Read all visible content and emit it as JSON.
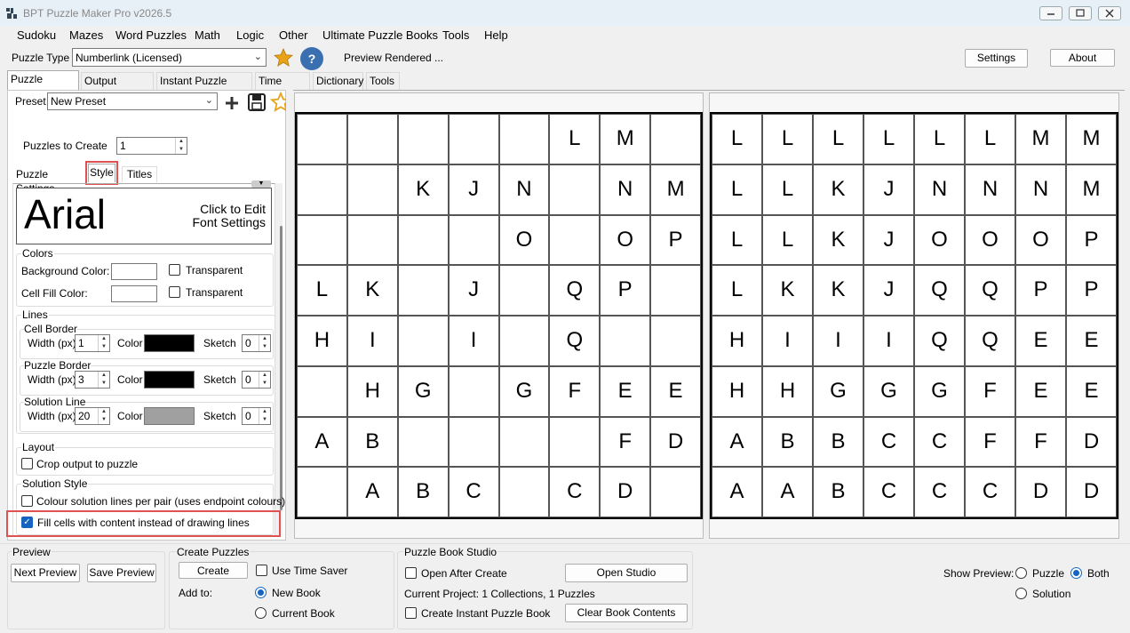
{
  "window": {
    "title": "BPT Puzzle Maker Pro v2026.5"
  },
  "menu": [
    "Sudoku",
    "Mazes",
    "Word Puzzles",
    "Math",
    "Logic",
    "Other",
    "Ultimate Puzzle Books",
    "Tools",
    "Help"
  ],
  "toolbar": {
    "puzzle_type_label": "Puzzle Type",
    "puzzle_type_value": "Numberlink (Licensed)",
    "status": "Preview Rendered ...",
    "settings_label": "Settings",
    "about_label": "About",
    "help_glyph": "?"
  },
  "main_tabs": [
    "Puzzle Settings",
    "Output Settings",
    "Instant Puzzle Books",
    "Time Saver",
    "Dictionary",
    "Tools"
  ],
  "preset": {
    "label": "Preset",
    "value": "New Preset"
  },
  "puzzles_to_create": {
    "label": "Puzzles to Create",
    "value": "1"
  },
  "sub_tabs": [
    "Puzzle Settings",
    "Style",
    "Titles"
  ],
  "font_preview": {
    "font_name": "Arial",
    "hint_line1": "Click to Edit",
    "hint_line2": "Font Settings"
  },
  "colors": {
    "heading": "Colors",
    "background_label": "Background Color:",
    "cell_fill_label": "Cell Fill Color:",
    "transparent_label": "Transparent"
  },
  "lines": {
    "heading": "Lines",
    "width_label": "Width (px)",
    "color_label": "Color",
    "sketch_label": "Sketch",
    "cell_border": {
      "title": "Cell Border",
      "width": "1",
      "sketch": "0",
      "color": "#000000"
    },
    "puzzle_border": {
      "title": "Puzzle Border",
      "width": "3",
      "sketch": "0",
      "color": "#000000"
    },
    "solution_line": {
      "title": "Solution Line",
      "width": "20",
      "sketch": "0",
      "color": "#a0a0a0"
    }
  },
  "layout": {
    "heading": "Layout",
    "crop_label": "Crop output to puzzle"
  },
  "solution_style": {
    "heading": "Solution Style",
    "colour_lines_label": "Colour solution lines per pair (uses endpoint colours)",
    "fill_cells_label": "Fill cells with content instead of drawing lines",
    "fill_cells_checked": true
  },
  "puzzle_grid": [
    [
      "",
      "",
      "",
      "",
      "",
      "L",
      "M",
      ""
    ],
    [
      "",
      "",
      "K",
      "J",
      "N",
      "",
      "N",
      "M"
    ],
    [
      "",
      "",
      "",
      "",
      "O",
      "",
      "O",
      "P"
    ],
    [
      "L",
      "K",
      "",
      "J",
      "",
      "Q",
      "P",
      ""
    ],
    [
      "H",
      "I",
      "",
      "I",
      "",
      "Q",
      "",
      ""
    ],
    [
      "",
      "H",
      "G",
      "",
      "G",
      "F",
      "E",
      "E"
    ],
    [
      "A",
      "B",
      "",
      "",
      "",
      "",
      "F",
      "D"
    ],
    [
      "",
      "A",
      "B",
      "C",
      "",
      "C",
      "D",
      ""
    ]
  ],
  "solution_grid": [
    [
      "L",
      "L",
      "L",
      "L",
      "L",
      "L",
      "M",
      "M"
    ],
    [
      "L",
      "L",
      "K",
      "J",
      "N",
      "N",
      "N",
      "M"
    ],
    [
      "L",
      "L",
      "K",
      "J",
      "O",
      "O",
      "O",
      "P"
    ],
    [
      "L",
      "K",
      "K",
      "J",
      "Q",
      "Q",
      "P",
      "P"
    ],
    [
      "H",
      "I",
      "I",
      "I",
      "Q",
      "Q",
      "E",
      "E"
    ],
    [
      "H",
      "H",
      "G",
      "G",
      "G",
      "F",
      "E",
      "E"
    ],
    [
      "A",
      "B",
      "B",
      "C",
      "C",
      "F",
      "F",
      "D"
    ],
    [
      "A",
      "A",
      "B",
      "C",
      "C",
      "C",
      "D",
      "D"
    ]
  ],
  "preview_group": {
    "heading": "Preview",
    "next_label": "Next Preview",
    "save_label": "Save Preview"
  },
  "create_group": {
    "heading": "Create Puzzles",
    "create_label": "Create",
    "use_time_saver_label": "Use Time Saver",
    "add_to_label": "Add to:",
    "new_book_label": "New Book",
    "current_book_label": "Current Book"
  },
  "studio_group": {
    "heading": "Puzzle Book Studio",
    "open_after_label": "Open After Create",
    "open_studio_label": "Open Studio",
    "current_project": "Current Project: 1 Collections, 1 Puzzles",
    "instant_book_label": "Create Instant Puzzle Book",
    "clear_label": "Clear Book Contents"
  },
  "show_preview": {
    "label": "Show Preview:",
    "puzzle": "Puzzle",
    "both": "Both",
    "solution": "Solution"
  },
  "accent_color": "#1565c0",
  "highlight_color": "#e05252"
}
